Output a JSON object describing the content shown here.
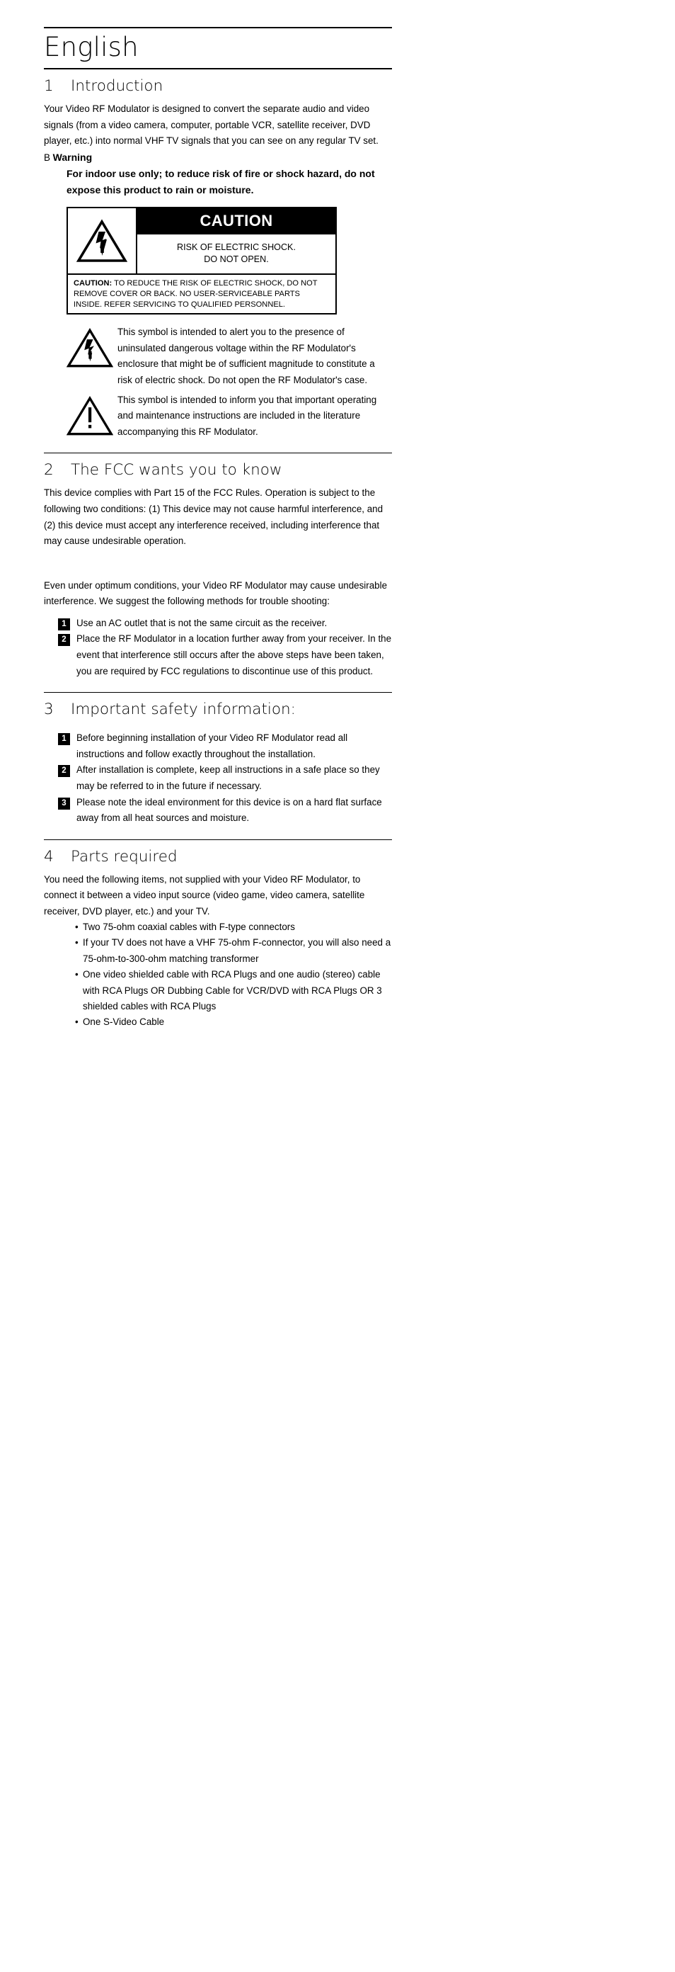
{
  "document": {
    "language_title": "English"
  },
  "section1": {
    "number": "1",
    "title": "Introduction",
    "paragraph": "Your Video RF Modulator is designed to convert the separate audio and video signals (from a video camera, computer, portable VCR, satellite receiver, DVD player, etc.) into normal VHF TV signals that you can see on any regular TV set.",
    "warning_icon": "B",
    "warning_label": "Warning",
    "warning_body": "For indoor use only; to reduce risk of fire or shock hazard, do not expose this product to rain or moisture.",
    "caution_box": {
      "lightning_icon": "lightning-bolt-triangle-icon",
      "heading": "CAUTION",
      "risk_line1": "RISK OF ELECTRIC SHOCK.",
      "risk_line2": "DO NOT OPEN.",
      "bottom_bold": "CAUTION:",
      "bottom_text": " TO REDUCE THE RISK OF ELECTRIC SHOCK, DO NOT REMOVE COVER OR BACK. NO USER-SERVICEABLE PARTS INSIDE. REFER SERVICING TO QUALIFIED  PERSONNEL."
    },
    "symbol_notes": [
      {
        "icon": "lightning-bolt-triangle-icon",
        "text": "This symbol is intended to alert you to the presence of uninsulated dangerous voltage within the RF Modulator's enclosure that might be of sufficient magnitude to constitute a risk of electric shock. Do not open the RF Modulator's case."
      },
      {
        "icon": "exclamation-triangle-icon",
        "text": "This symbol is intended to inform you that important operating and maintenance instructions are included in the literature accompanying this RF Modulator."
      }
    ]
  },
  "section2": {
    "number": "2",
    "title": "The FCC wants you to know",
    "paragraph1": "This device complies with Part 15 of the FCC Rules. Operation is subject to the following two conditions: (1) This device may not cause harmful interference, and (2) this device must accept any interference received, including interference that may cause undesirable operation.",
    "paragraph2": "Even under optimum conditions, your Video RF Modulator may cause undesirable interference. We suggest the following methods for trouble shooting:",
    "items": [
      {
        "num": "1",
        "text": "Use an AC outlet that is not the same circuit as the receiver."
      },
      {
        "num": "2",
        "text": "Place the RF Modulator in a location further away from your receiver. In the event that interference still occurs after the above steps have been taken, you are required by FCC regulations to discontinue use of this product."
      }
    ]
  },
  "section3": {
    "number": "3",
    "title": "Important safety information:",
    "items": [
      {
        "num": "1",
        "text": "Before beginning installation of your Video RF Modulator read all instructions and follow exactly throughout the installation."
      },
      {
        "num": "2",
        "text": "After installation is complete, keep all instructions in a safe place so they may be referred to in the future if necessary."
      },
      {
        "num": "3",
        "text": "Please note the ideal environment for this device is on a hard flat surface away from all heat sources and moisture."
      }
    ]
  },
  "section4": {
    "number": "4",
    "title": "Parts required",
    "paragraph": "You need the following items, not supplied with your Video RF Modulator, to connect it between a video input source (video game, video camera, satellite receiver, DVD player, etc.) and your TV.",
    "bullets": [
      "Two 75-ohm coaxial cables with F-type connectors",
      "If your TV does not have a VHF 75-ohm F-connector, you will also need a 75-ohm-to-300-ohm matching transformer",
      "One video shielded cable with RCA Plugs and one audio (stereo) cable with RCA Plugs OR Dubbing Cable for VCR/DVD with RCA Plugs OR 3 shielded cables with RCA Plugs",
      "One S-Video Cable"
    ]
  }
}
